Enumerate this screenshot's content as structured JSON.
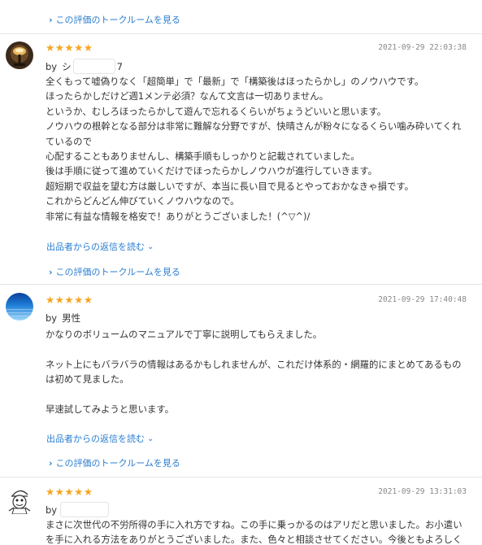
{
  "colors": {
    "link": "#2b7ed0",
    "star": "#f5a623",
    "date": "#888888",
    "text": "#333333"
  },
  "top_talkroom_link": "この評価のトークルームを見る",
  "reviews": [
    {
      "rating": 5,
      "stars": "★★★★★",
      "date": "2021-09-29 22:03:38",
      "by_prefix": "by",
      "author_visible": "シ",
      "author_suffix": "7",
      "avatar_icon": "lamp-photo-avatar",
      "lines": [
        "全くもって嘘偽りなく「超簡単」で「最新」で「構築後はほったらかし」のノウハウです。",
        "ほったらかしだけど週1メンテ必須？なんて文言は一切ありません。",
        "というか、むしろほったらかして遊んで忘れるくらいがちょうどいいと思います。",
        "ノウハウの根幹となる部分は非常に難解な分野ですが、快晴さんが粉々になるくらい噛み砕いてくれ",
        "ているので",
        "心配することもありませんし、構築手順もしっかりと記載されていました。",
        "後は手順に従って進めていくだけでほったらかしノウハウが進行していきます。",
        "超短期で収益を望む方は厳しいですが、本当に長い目で見るとやっておかなきゃ損です。",
        "これからどんどん伸びていくノウハウなので。",
        "非常に有益な情報を格安で！ありがとうございました！(^▽^)/"
      ],
      "reply_link": "出品者からの返信を読む",
      "talkroom_link": "この評価のトークルームを見る"
    },
    {
      "rating": 5,
      "stars": "★★★★★",
      "date": "2021-09-29 17:40:48",
      "by_prefix": "by",
      "author_visible": "男性",
      "author_suffix": "",
      "avatar_icon": "blue-gradient-avatar",
      "lines": [
        "かなりのボリュームのマニュアルで丁寧に説明してもらえました。",
        "",
        "ネット上にもバラバラの情報はあるかもしれませんが、これだけ体系的・網羅的にまとめてあるもの",
        "は初めて見ました。",
        "",
        "早速試してみようと思います。"
      ],
      "reply_link": "出品者からの返信を読む",
      "talkroom_link": "この評価のトークルームを見る"
    },
    {
      "rating": 5,
      "stars": "★★★★★",
      "date": "2021-09-29 13:31:03",
      "by_prefix": "by",
      "author_visible": "",
      "author_suffix": "",
      "avatar_icon": "cartoon-character-avatar",
      "lines": [
        "まさに次世代の不労所得の手に入れ方ですね。この手に乗っかるのはアリだと思いました。お小遣い",
        "を手に入れる方法をありがとうございました。また、色々と相談させてください。今後ともよろしく"
      ]
    }
  ]
}
